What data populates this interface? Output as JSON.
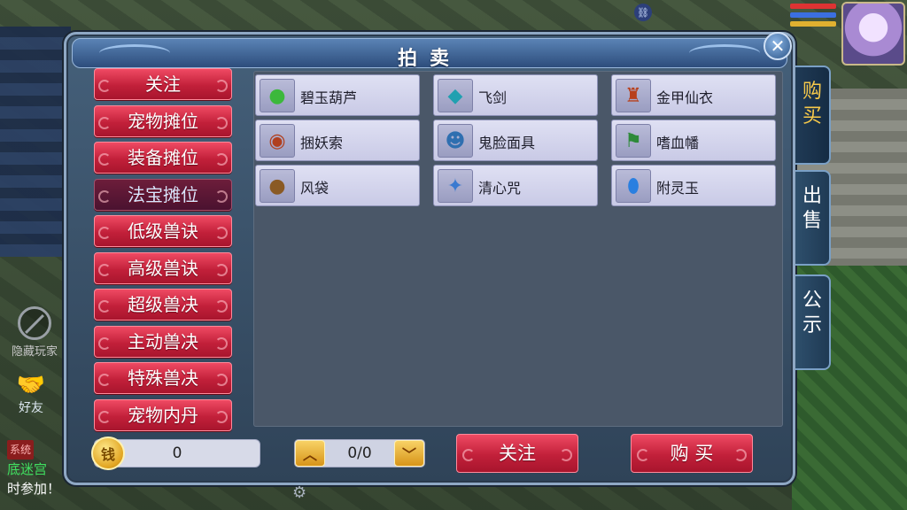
{
  "title": "拍卖",
  "categories": [
    {
      "label": "关注"
    },
    {
      "label": "宠物摊位"
    },
    {
      "label": "装备摊位"
    },
    {
      "label": "法宝摊位",
      "active": true
    },
    {
      "label": "低级兽诀"
    },
    {
      "label": "高级兽诀"
    },
    {
      "label": "超级兽决"
    },
    {
      "label": "主动兽决"
    },
    {
      "label": "特殊兽决"
    },
    {
      "label": "宠物内丹"
    }
  ],
  "items": [
    {
      "name": "碧玉葫芦",
      "icon": "gourd-icon"
    },
    {
      "name": "飞剑",
      "icon": "flying-sword-icon"
    },
    {
      "name": "金甲仙衣",
      "icon": "golden-armor-icon"
    },
    {
      "name": "捆妖索",
      "icon": "binding-rope-icon"
    },
    {
      "name": "鬼脸面具",
      "icon": "ghost-mask-icon"
    },
    {
      "name": "嗜血幡",
      "icon": "blood-banner-icon"
    },
    {
      "name": "风袋",
      "icon": "wind-bag-icon"
    },
    {
      "name": "清心咒",
      "icon": "heart-mantra-icon"
    },
    {
      "name": "附灵玉",
      "icon": "spirit-jade-icon"
    }
  ],
  "tabs": {
    "buy": "购买",
    "sell": "出售",
    "notice": "公示"
  },
  "money": "0",
  "page": "0/0",
  "buttons": {
    "follow": "关注",
    "buy": "购 买"
  },
  "hud": {
    "hide_players": "隐藏玩家",
    "friends": "好友",
    "chat_tag": "系统",
    "chat_line1": "底迷宫",
    "chat_line2": "时参加！"
  }
}
